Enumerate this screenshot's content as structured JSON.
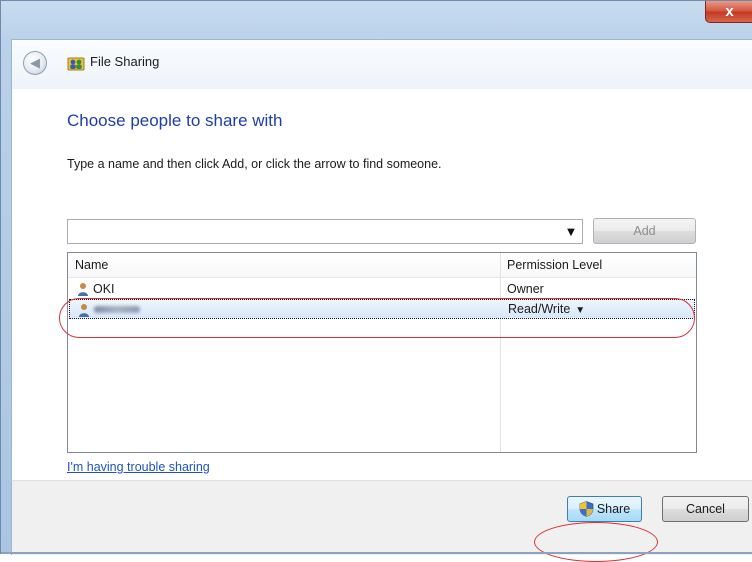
{
  "window": {
    "close_glyph": "x",
    "app_title": "File Sharing"
  },
  "main": {
    "heading": "Choose people to share with",
    "instruction": "Type a name and then click Add, or click the arrow to find someone.",
    "name_input_value": "",
    "add_label": "Add",
    "list": {
      "columns": [
        "Name",
        "Permission Level"
      ],
      "rows": [
        {
          "name": "OKI",
          "permission": "Owner"
        },
        {
          "name": "",
          "permission": "Read/Write",
          "selected": true,
          "name_obscured": true
        }
      ]
    },
    "trouble_link": "I'm having trouble sharing"
  },
  "footer": {
    "share_label": "Share",
    "cancel_label": "Cancel"
  },
  "colors": {
    "heading": "#1e3ea8",
    "link": "#1e52c4",
    "highlight": "#d9303a",
    "selection": "#d7e7f9"
  },
  "icons": {
    "back": "back-arrow-icon",
    "app": "file-sharing-people-icon",
    "user": "user-icon",
    "shield": "uac-shield-icon",
    "dropdown": "dropdown-arrow-icon"
  }
}
